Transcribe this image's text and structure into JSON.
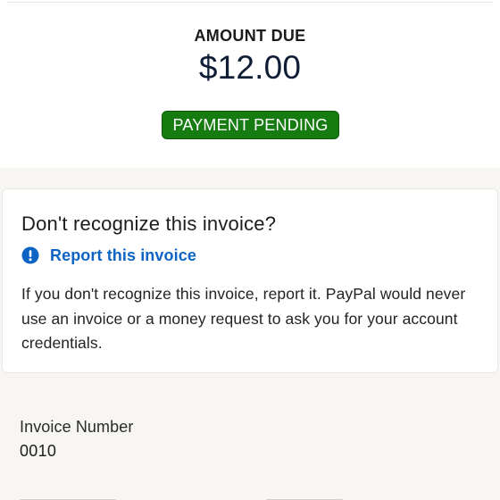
{
  "summary": {
    "amount_label": "AMOUNT DUE",
    "amount_value": "$12.00",
    "status": "PAYMENT PENDING",
    "status_color": "#167c12"
  },
  "notice": {
    "title": "Don't recognize this invoice?",
    "report_icon": "info-circle-icon",
    "report_label": "Report this invoice",
    "report_color": "#0d64c4",
    "body": "If you don't recognize this invoice, report it. PayPal would never use an invoice or a money request to ask you for your account credentials."
  },
  "details": {
    "invoice_number_label": "Invoice Number",
    "invoice_number_value": "0010"
  }
}
